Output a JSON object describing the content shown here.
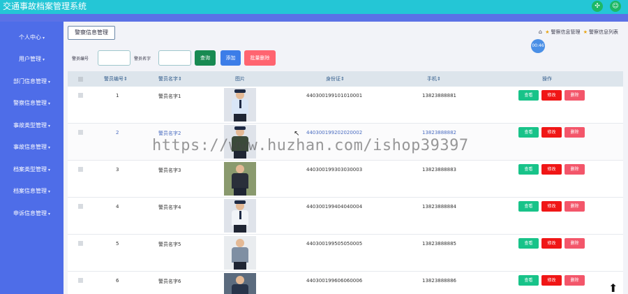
{
  "app": {
    "title": "交通事故档案管理系统"
  },
  "sidebar": {
    "items": [
      {
        "label": "个人中心"
      },
      {
        "label": "用户管理"
      },
      {
        "label": "部门信息管理"
      },
      {
        "label": "警察信息管理"
      },
      {
        "label": "事故类型管理"
      },
      {
        "label": "事故信息管理"
      },
      {
        "label": "档案类型管理"
      },
      {
        "label": "档案信息管理"
      },
      {
        "label": "申诉信息管理"
      }
    ]
  },
  "tab": {
    "label": "警察信息管理"
  },
  "breadcrumb": {
    "item1": "警察信息管理",
    "item2": "警察信息列表"
  },
  "timer": "00:46",
  "search": {
    "field1_label": "警员编号",
    "field2_label": "警员名字",
    "query_label": "查询",
    "add_label": "添加",
    "batch_delete_label": "批量删除"
  },
  "table": {
    "columns": [
      "警员编号",
      "警员名字",
      "图片",
      "身份证",
      "手机",
      "操作"
    ],
    "rows": [
      {
        "id": "1",
        "name": "警员名字1",
        "idcard": "440300199101010001",
        "phone": "13823888881"
      },
      {
        "id": "2",
        "name": "警员名字2",
        "idcard": "440300199202020002",
        "phone": "13823888882"
      },
      {
        "id": "3",
        "name": "警员名字3",
        "idcard": "440300199303030003",
        "phone": "13823888883"
      },
      {
        "id": "4",
        "name": "警员名字4",
        "idcard": "440300199404040004",
        "phone": "13823888884"
      },
      {
        "id": "5",
        "name": "警员名字5",
        "idcard": "440300199505050005",
        "phone": "13823888885"
      },
      {
        "id": "6",
        "name": "警员名字6",
        "idcard": "440300199606060006",
        "phone": "13823888886"
      }
    ],
    "actions": {
      "view": "查看",
      "edit": "修改",
      "delete": "删除"
    }
  },
  "watermark": "https://www.huzhan.com/ishop39397",
  "colors": {
    "topbar": "#24c6d6",
    "sidebar": "#4e6de8",
    "view": "#18c389",
    "edit": "#f01616",
    "delete": "#f3566a"
  }
}
